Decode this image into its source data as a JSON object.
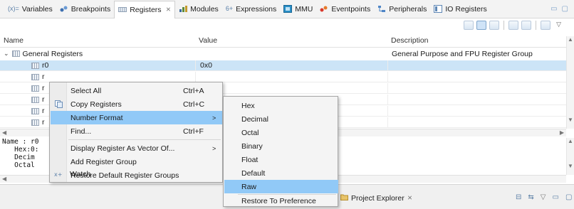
{
  "tabs": [
    {
      "label": "Variables",
      "icon": "variables-icon",
      "active": false
    },
    {
      "label": "Breakpoints",
      "icon": "breakpoints-icon",
      "active": false
    },
    {
      "label": "Registers",
      "icon": "registers-icon",
      "active": true,
      "close": "⨯"
    },
    {
      "label": "Modules",
      "icon": "modules-icon",
      "active": false
    },
    {
      "label": "Expressions",
      "icon": "expressions-icon",
      "active": false
    },
    {
      "label": "MMU",
      "icon": "mmu-icon",
      "active": false
    },
    {
      "label": "Eventpoints",
      "icon": "eventpoints-icon",
      "active": false
    },
    {
      "label": "Peripherals",
      "icon": "peripherals-icon",
      "active": false
    },
    {
      "label": "IO Registers",
      "icon": "io-registers-icon",
      "active": false
    }
  ],
  "table": {
    "columns": [
      "Name",
      "Value",
      "Description"
    ],
    "group": {
      "name": "General Registers",
      "description": "General Purpose and FPU Register Group"
    },
    "rows": [
      {
        "name": "r0",
        "value": "0x0",
        "selected": true
      },
      {
        "name": "r",
        "value": ""
      },
      {
        "name": "r",
        "value": ""
      },
      {
        "name": "r",
        "value": ""
      },
      {
        "name": "r",
        "value": ""
      },
      {
        "name": "r",
        "value": ""
      }
    ]
  },
  "detail": {
    "lines": [
      "Name : r0",
      "   Hex:0:",
      "   Decim",
      "   Octal"
    ]
  },
  "bottom": {
    "project_explorer_label": "Project Explorer",
    "close": "⨯"
  },
  "context_menu": {
    "items": [
      {
        "label": "Select All",
        "shortcut": "Ctrl+A"
      },
      {
        "label": "Copy Registers",
        "shortcut": "Ctrl+C",
        "icon": "copy-icon"
      },
      {
        "label": "Number Format",
        "shortcut": "",
        "submenu": true,
        "highlighted": true
      },
      {
        "label": "Find...",
        "shortcut": "Ctrl+F"
      },
      {
        "label": "Display Register As Vector Of...",
        "shortcut": "",
        "submenu": true
      },
      {
        "label": "Add Register Group",
        "shortcut": ""
      },
      {
        "label": "Restore Default Register Groups",
        "shortcut": ""
      },
      {
        "label": "Watch",
        "shortcut": "",
        "icon": "watch-icon"
      }
    ],
    "submenu_arrow": ">"
  },
  "number_format_menu": {
    "items": [
      "Hex",
      "Decimal",
      "Octal",
      "Binary",
      "Float",
      "Default",
      "Raw",
      "Restore To Preference"
    ],
    "highlighted": "Raw"
  },
  "colors": {
    "selection": "#cce4f7",
    "menu_highlight": "#91c9f7",
    "tab_bg": "#f3f3f3"
  }
}
